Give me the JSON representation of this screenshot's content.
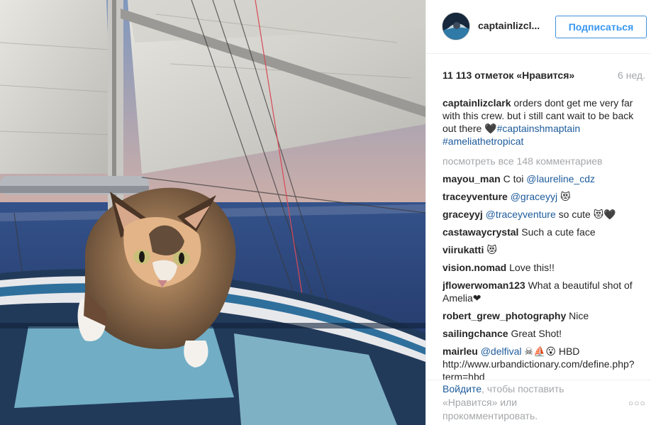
{
  "post": {
    "photo_alt": "Кошка лежит на тенте парусной яхты на фоне моря и закатного неба",
    "username": "captainlizcl...",
    "follow_label": "Подписаться",
    "likes_text": "11 113 отметок «Нравится»",
    "time_text": "6 нед."
  },
  "caption": {
    "username": "captainlizclark",
    "text": " orders dont get me very far with this crew. but i still cant wait to be back out there 🖤",
    "hashtags": [
      "#captainshmaptain",
      "#ameliathetropicat"
    ]
  },
  "view_all_comments": "посмотреть все 148 комментариев",
  "comments": [
    {
      "user": "mayou_man",
      "pre": " C toi ",
      "mention": "@laureline_cdz",
      "post": ""
    },
    {
      "user": "traceyventure",
      "pre": " ",
      "mention": "@graceyyj",
      "post": " 😻"
    },
    {
      "user": "graceyyj",
      "pre": " ",
      "mention": "@traceyventure",
      "post": " so cute 😻🖤"
    },
    {
      "user": "castawaycrystal",
      "pre": " Such a cute face",
      "mention": "",
      "post": ""
    },
    {
      "user": "viirukatti",
      "pre": " 😻",
      "mention": "",
      "post": ""
    },
    {
      "user": "vision.nomad",
      "pre": " Love this!!",
      "mention": "",
      "post": ""
    },
    {
      "user": "jflowerwoman123",
      "pre": " What a beautiful shot of Amelia❤",
      "mention": "",
      "post": ""
    },
    {
      "user": "robert_grew_photography",
      "pre": " Nice",
      "mention": "",
      "post": ""
    },
    {
      "user": "sailingchance",
      "pre": " Great Shot!",
      "mention": "",
      "post": ""
    },
    {
      "user": "mairleu",
      "pre": " ",
      "mention": "@delfival",
      "post": " ☠⛵😮 HBD http://www.urbandictionary.com/define.php?term=hbd"
    }
  ],
  "footer": {
    "login_link": "Войдите",
    "login_text": ", чтобы поставить «Нравится» или прокомментировать.",
    "more_icon": "more-options-icon"
  },
  "colors": {
    "link_blue": "#1d5b9b",
    "button_blue": "#3897f0",
    "muted_gray": "#a5a7aa"
  }
}
